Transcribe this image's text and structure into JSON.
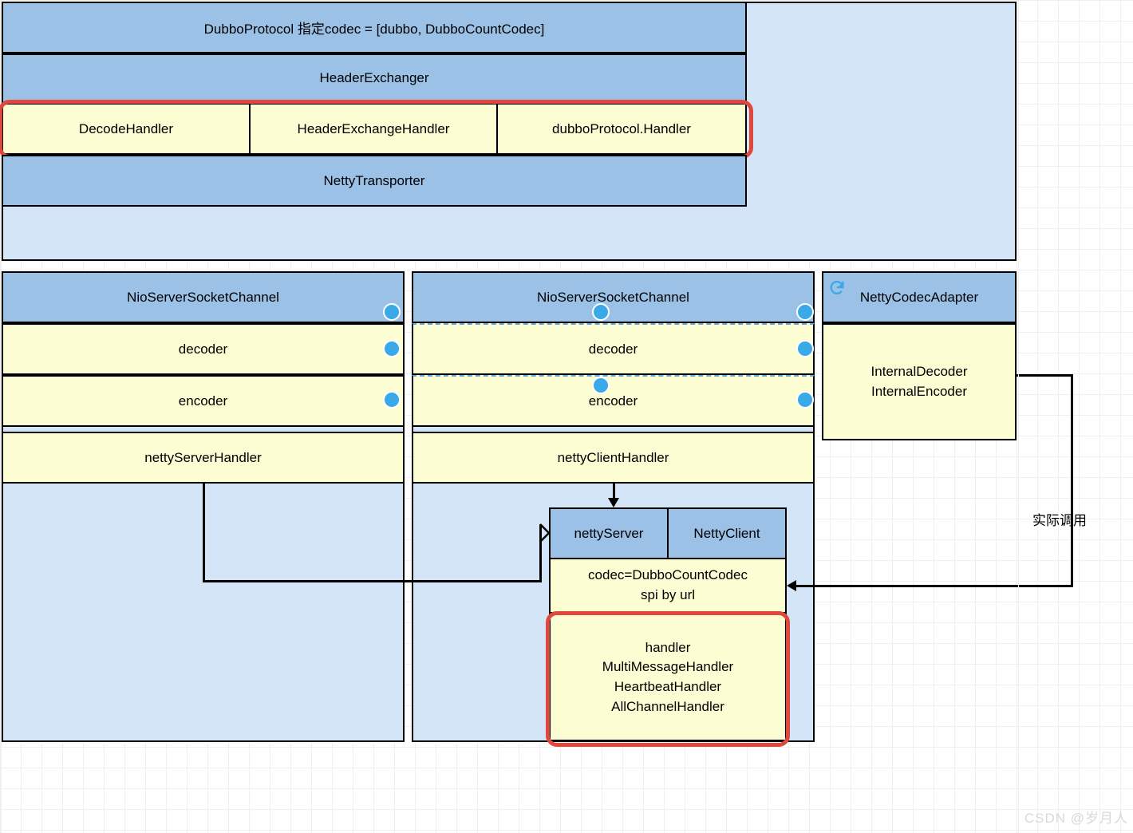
{
  "top": {
    "title": "DubboProtocol 指定codec = [dubbo, DubboCountCodec]",
    "row1": "HeaderExchanger",
    "handlers": {
      "a": "DecodeHandler",
      "b": "HeaderExchangeHandler",
      "c": "dubboProtocol.Handler"
    },
    "row2": "NettyTransporter"
  },
  "server": {
    "header": "NioServerSocketChannel",
    "decoder": "decoder",
    "encoder": "encoder",
    "handler": "nettyServerHandler"
  },
  "client": {
    "header": "NioServerSocketChannel",
    "decoder": "decoder",
    "encoder": "encoder",
    "handler": "nettyClientHandler"
  },
  "adapter": {
    "header": "NettyCodecAdapter",
    "line1": "InternalDecoder",
    "line2": "InternalEncoder"
  },
  "netty": {
    "leftHead": "nettyServer",
    "rightHead": "NettyClient",
    "codecLine1": "codec=DubboCountCodec",
    "codecLine2": "spi by url",
    "h1": "handler",
    "h2": "MultiMessageHandler",
    "h3": "HeartbeatHandler",
    "h4": "AllChannelHandler"
  },
  "label": "实际调用",
  "watermark": "CSDN @岁月人"
}
